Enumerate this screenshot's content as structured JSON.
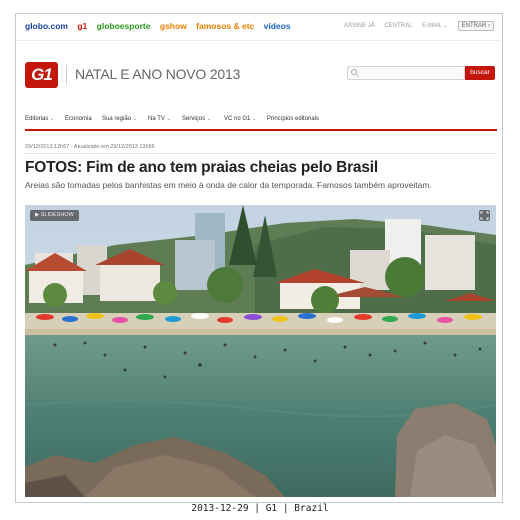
{
  "global_nav": {
    "links": [
      {
        "label": "globo.com",
        "color": "#1a3f9f"
      },
      {
        "label": "g1",
        "color": "#c4170c"
      },
      {
        "label": "globoesporte",
        "color": "#2a9a1a"
      },
      {
        "label": "gshow",
        "color": "#f07d00"
      },
      {
        "label": "famosos & etc",
        "color": "#e67e00"
      },
      {
        "label": "vídeos",
        "color": "#1b64c6"
      }
    ],
    "utility": {
      "assine": "ASSINE JÁ",
      "central": "CENTRAL",
      "email": "E-MAIL",
      "entrar": "ENTRAR"
    }
  },
  "header": {
    "logo_text": "G1",
    "section_title": "NATAL E ANO NOVO 2013",
    "search_button": "buscar"
  },
  "menu": {
    "items": [
      "Editorias",
      "Economia",
      "Sua região",
      "Na TV",
      "Serviços",
      "VC no G1",
      "Princípios editoriais"
    ]
  },
  "article": {
    "dateline": "29/12/2013 12h57 - Atualizado em 29/12/2013 13h56",
    "headline": "FOTOS: Fim de ano tem praias cheias pelo Brasil",
    "subtitle": "Areias são tomadas pelos banhistas em meio à onda de calor da temporada. Famosos também aproveitam.",
    "slideshow_label": "SLIDESHOW"
  },
  "caption": "2013-12-29 | G1 | Brazil",
  "colors": {
    "brand_red": "#c4170c"
  }
}
